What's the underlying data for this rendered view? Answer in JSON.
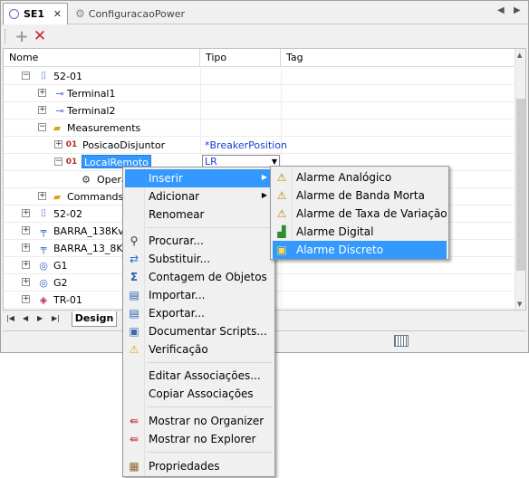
{
  "tabs": {
    "active_label": "SE1",
    "active_close": "✕",
    "inactive_label": "ConfiguracaoPower"
  },
  "toolbar": {
    "add_icon": "plus-icon",
    "delete_icon": "delete-x-icon"
  },
  "grid": {
    "columns": [
      "Nome",
      "Tipo",
      "Tag"
    ],
    "rows": [
      {
        "label": "52-01",
        "tipo": "",
        "icon": "breaker-icon"
      },
      {
        "label": "Terminal1",
        "tipo": "",
        "icon": "terminal-icon"
      },
      {
        "label": "Terminal2",
        "tipo": "",
        "icon": "terminal-icon"
      },
      {
        "label": "Measurements",
        "tipo": "",
        "icon": "folder-icon"
      },
      {
        "label": "PosicaoDisjuntor",
        "tipo": "*BreakerPosition",
        "icon": "measurement-icon"
      },
      {
        "label": "LocalRemoto",
        "tipo": "LR",
        "icon": "measurement-icon"
      },
      {
        "label": "Opera",
        "tipo": "",
        "icon": "operation-icon"
      },
      {
        "label": "Commands",
        "tipo": "",
        "icon": "folder-icon"
      },
      {
        "label": "52-02",
        "tipo": "",
        "icon": "breaker-icon"
      },
      {
        "label": "BARRA_138Kv",
        "tipo": "",
        "icon": "busbar-icon"
      },
      {
        "label": "BARRA_13_8Kv",
        "tipo": "",
        "icon": "busbar-icon"
      },
      {
        "label": "G1",
        "tipo": "",
        "icon": "generator-icon"
      },
      {
        "label": "G2",
        "tipo": "",
        "icon": "generator-icon"
      },
      {
        "label": "TR-01",
        "tipo": "",
        "icon": "transformer-icon"
      }
    ]
  },
  "sheet": {
    "tab_label": "Design"
  },
  "context_menu": {
    "items": {
      "inserir": "Inserir",
      "adicionar": "Adicionar",
      "renomear": "Renomear",
      "procurar": "Procurar...",
      "substituir": "Substituir...",
      "contagem": "Contagem de Objetos",
      "importar": "Importar...",
      "exportar": "Exportar...",
      "documentar": "Documentar Scripts...",
      "verificacao": "Verificação",
      "editar": "Editar Associações...",
      "copiar": "Copiar Associações",
      "organizer": "Mostrar no Organizer",
      "explorer": "Mostrar no Explorer",
      "propriedades": "Propriedades"
    }
  },
  "submenu": {
    "items": {
      "analogico": "Alarme Analógico",
      "banda_morta": "Alarme de Banda Morta",
      "taxa_variacao": "Alarme de Taxa de Variação",
      "digital": "Alarme Digital",
      "discreto": "Alarme Discreto"
    }
  },
  "colors": {
    "highlight": "#3399ff",
    "tipo_text": "#1a3fd0"
  }
}
